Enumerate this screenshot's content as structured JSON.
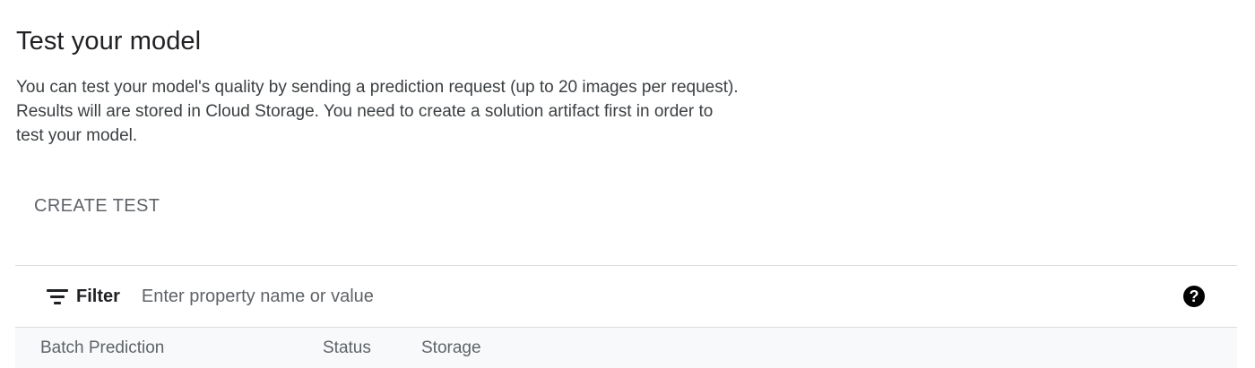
{
  "page": {
    "title": "Test your model",
    "description_lines": [
      "You can test your model's quality by sending a prediction request (up to 20 images per request).",
      "Results will are stored in Cloud Storage. You need to create a solution artifact first in order to",
      "test your model."
    ]
  },
  "actions": {
    "create_test_label": "CREATE TEST"
  },
  "filter": {
    "label": "Filter",
    "icon": "filter-list-icon",
    "placeholder": "Enter property name or value",
    "value": "",
    "help_icon": "help-circle-icon",
    "help_glyph": "?"
  },
  "table": {
    "columns": [
      "Batch Prediction",
      "Status",
      "Storage"
    ]
  }
}
